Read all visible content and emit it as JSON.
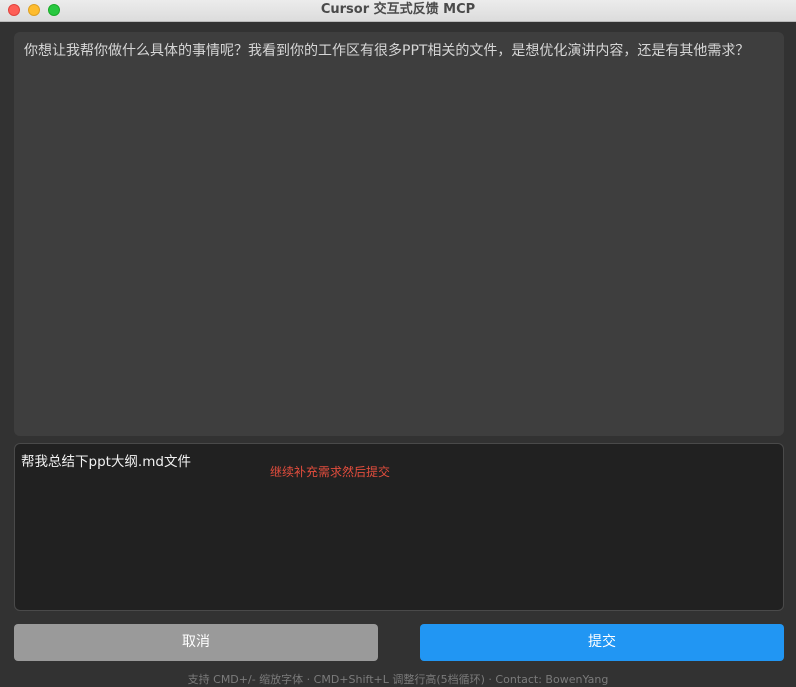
{
  "window": {
    "title": "Cursor 交互式反馈 MCP"
  },
  "message": {
    "text": "你想让我帮你做什么具体的事情呢？我看到你的工作区有很多PPT相关的文件，是想优化演讲内容，还是有其他需求？"
  },
  "input": {
    "value": "帮我总结下ppt大纲.md文件",
    "hint": "继续补充需求然后提交"
  },
  "buttons": {
    "cancel_label": "取消",
    "submit_label": "提交"
  },
  "footer": {
    "text": "支持 CMD+/- 缩放字体 · CMD+Shift+L 调整行高(5档循环) · Contact: BowenYang"
  },
  "colors": {
    "submit": "#2196f3",
    "cancel": "#9a9a9a",
    "hint": "#e24d3d",
    "background": "#323232"
  }
}
